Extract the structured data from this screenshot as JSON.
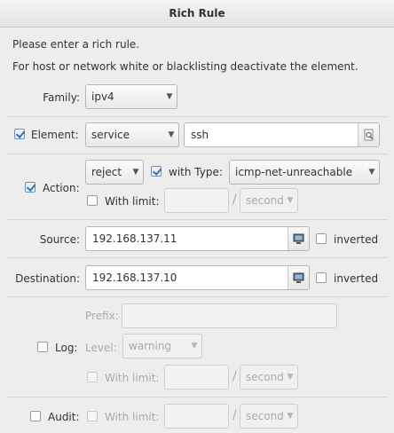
{
  "window": {
    "title": "Rich Rule"
  },
  "intro": {
    "line1": "Please enter a rich rule.",
    "line2": "For host or network white or blacklisting deactivate the element."
  },
  "family": {
    "label": "Family:",
    "value": "ipv4"
  },
  "element": {
    "label": "Element:",
    "checked": true,
    "type": "service",
    "value": "ssh",
    "button_icon": "search-icon"
  },
  "action": {
    "label": "Action:",
    "checked": true,
    "value": "reject",
    "with_type_label": "with Type:",
    "with_type_checked": true,
    "type_value": "icmp-net-unreachable",
    "limit_label": "With limit:",
    "limit_checked": false,
    "limit_value": "",
    "slash": "/",
    "unit": "second"
  },
  "source": {
    "label": "Source:",
    "value": "192.168.137.11",
    "inverted_label": "inverted",
    "inverted": false,
    "button_icon": "network-icon"
  },
  "destination": {
    "label": "Destination:",
    "value": "192.168.137.10",
    "inverted_label": "inverted",
    "inverted": false,
    "button_icon": "network-icon"
  },
  "log": {
    "label": "Log:",
    "checked": false,
    "prefix_label": "Prefix:",
    "prefix_value": "",
    "level_label": "Level:",
    "level_value": "warning",
    "limit_label": "With limit:",
    "limit_checked": false,
    "limit_value": "",
    "slash": "/",
    "unit": "second"
  },
  "audit": {
    "label": "Audit:",
    "checked": false,
    "limit_label": "With limit:",
    "limit_checked": false,
    "limit_value": "",
    "slash": "/",
    "unit": "second"
  }
}
